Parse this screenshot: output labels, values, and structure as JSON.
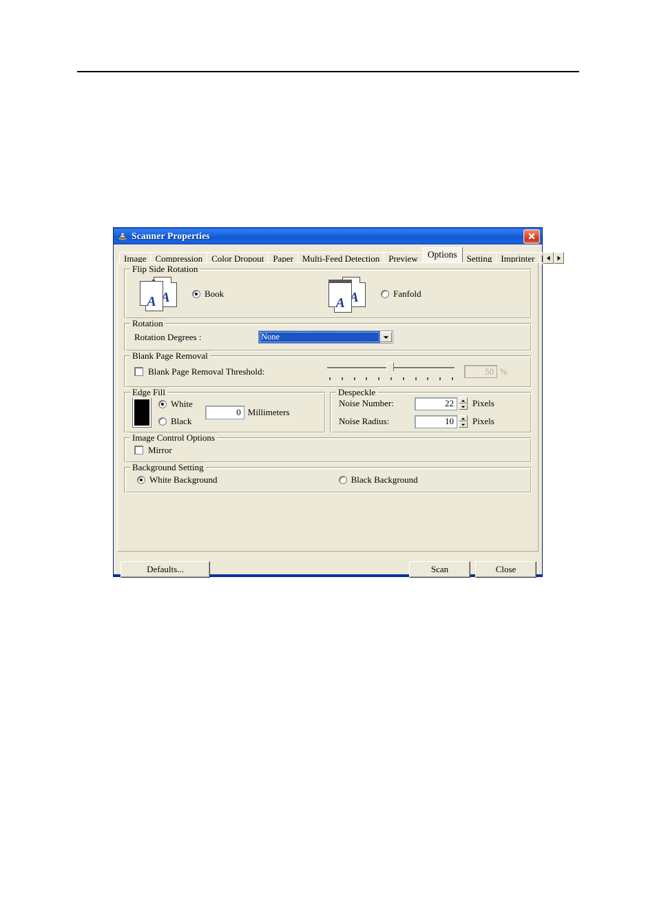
{
  "window": {
    "title": "Scanner Properties",
    "icon": "scanner-icon",
    "close_label": "✕"
  },
  "tabs": [
    {
      "label": "Image",
      "active": false
    },
    {
      "label": "Compression",
      "active": false
    },
    {
      "label": "Color Dropout",
      "active": false
    },
    {
      "label": "Paper",
      "active": false
    },
    {
      "label": "Multi-Feed Detection",
      "active": false
    },
    {
      "label": "Preview",
      "active": false
    },
    {
      "label": "Options",
      "active": true
    },
    {
      "label": "Setting",
      "active": false
    },
    {
      "label": "Imprinter",
      "active": false
    },
    {
      "label": "In",
      "active": false
    }
  ],
  "tab_scroll": {
    "prev": "◀",
    "next": "▶"
  },
  "groups": {
    "flip_side_rotation": {
      "title": "Flip Side Rotation",
      "options": [
        {
          "label": "Book",
          "selected": true,
          "icon": "book-pages-icon"
        },
        {
          "label": "Fanfold",
          "selected": false,
          "icon": "fanfold-pages-icon"
        }
      ],
      "page_letter": "A"
    },
    "rotation": {
      "title": "Rotation",
      "degrees_label": "Rotation Degrees :",
      "degrees_value": "None",
      "dropdown_icon": "chevron-down-icon"
    },
    "blank_page_removal": {
      "title": "Blank Page Removal",
      "threshold_label": "Blank Page Removal Threshold:",
      "threshold_checked": false,
      "slider_value": 50,
      "slider_min": 0,
      "slider_max": 100,
      "tick_count": 11,
      "percent_value": "50",
      "percent_unit": "%"
    },
    "edge_fill": {
      "title": "Edge Fill",
      "swatch_color": "#000000",
      "options": [
        {
          "label": "White",
          "selected": true
        },
        {
          "label": "Black",
          "selected": false
        }
      ],
      "amount_value": "0",
      "amount_unit": "Millimeters"
    },
    "despeckle": {
      "title": "Despeckle",
      "rows": [
        {
          "label": "Noise Number:",
          "value": "22",
          "unit": "Pixels"
        },
        {
          "label": "Noise Radius:",
          "value": "10",
          "unit": "Pixels"
        }
      ],
      "spin_up_icon": "caret-up-icon",
      "spin_down_icon": "caret-down-icon"
    },
    "image_control_options": {
      "title": "Image Control Options",
      "mirror_label": "Mirror",
      "mirror_checked": false
    },
    "background_setting": {
      "title": "Background Setting",
      "options": [
        {
          "label": "White Background",
          "selected": true
        },
        {
          "label": "Black Background",
          "selected": false
        }
      ]
    }
  },
  "footer": {
    "defaults_label": "Defaults...",
    "scan_label": "Scan",
    "close_label": "Close"
  },
  "colors": {
    "titlebar_blue": "#1459d6",
    "dialog_face": "#ece9d8",
    "selection_blue": "#1b55c4",
    "close_red": "#c9331b",
    "letter_blue": "#283c8c",
    "border_shadow": "#aca899"
  }
}
